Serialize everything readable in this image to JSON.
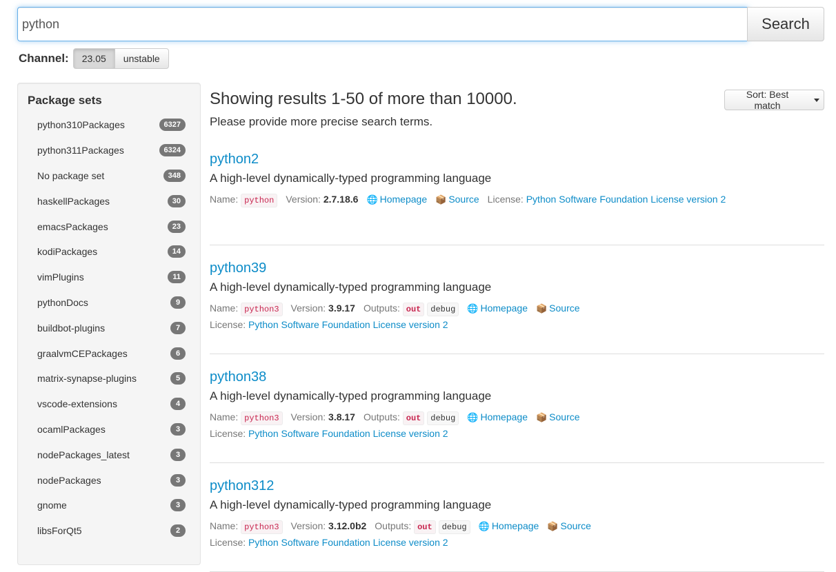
{
  "search": {
    "value": "python",
    "button_label": "Search"
  },
  "channel": {
    "label": "Channel:",
    "options": [
      "23.05",
      "unstable"
    ],
    "selected": "23.05"
  },
  "sidebar": {
    "title": "Package sets",
    "items": [
      {
        "label": "python310Packages",
        "count": "6327"
      },
      {
        "label": "python311Packages",
        "count": "6324"
      },
      {
        "label": "No package set",
        "count": "348"
      },
      {
        "label": "haskellPackages",
        "count": "30"
      },
      {
        "label": "emacsPackages",
        "count": "23"
      },
      {
        "label": "kodiPackages",
        "count": "14"
      },
      {
        "label": "vimPlugins",
        "count": "11"
      },
      {
        "label": "pythonDocs",
        "count": "9"
      },
      {
        "label": "buildbot-plugins",
        "count": "7"
      },
      {
        "label": "graalvmCEPackages",
        "count": "6"
      },
      {
        "label": "matrix-synapse-plugins",
        "count": "5"
      },
      {
        "label": "vscode-extensions",
        "count": "4"
      },
      {
        "label": "ocamlPackages",
        "count": "3"
      },
      {
        "label": "nodePackages_latest",
        "count": "3"
      },
      {
        "label": "nodePackages",
        "count": "3"
      },
      {
        "label": "gnome",
        "count": "3"
      },
      {
        "label": "libsForQt5",
        "count": "2"
      }
    ]
  },
  "main": {
    "heading": "Showing results 1-50 of more than 10000.",
    "subheading": "Please provide more precise search terms.",
    "sort_label": "Sort: Best match"
  },
  "labels": {
    "name": "Name:",
    "version": "Version:",
    "outputs": "Outputs:",
    "license": "License:",
    "homepage": "Homepage",
    "source": "Source"
  },
  "icons": {
    "homepage": "globe-icon",
    "source": "package-icon"
  },
  "results": [
    {
      "title": "python2",
      "description": "A high-level dynamically-typed programming language",
      "attr_name": "python",
      "version": "2.7.18.6",
      "outputs": [],
      "license": "Python Software Foundation License version 2"
    },
    {
      "title": "python39",
      "description": "A high-level dynamically-typed programming language",
      "attr_name": "python3",
      "version": "3.9.17",
      "outputs": [
        "out",
        "debug"
      ],
      "license": "Python Software Foundation License version 2"
    },
    {
      "title": "python38",
      "description": "A high-level dynamically-typed programming language",
      "attr_name": "python3",
      "version": "3.8.17",
      "outputs": [
        "out",
        "debug"
      ],
      "license": "Python Software Foundation License version 2"
    },
    {
      "title": "python312",
      "description": "A high-level dynamically-typed programming language",
      "attr_name": "python3",
      "version": "3.12.0b2",
      "outputs": [
        "out",
        "debug"
      ],
      "license": "Python Software Foundation License version 2"
    }
  ],
  "colors": {
    "link": "#0d8cc8",
    "badge": "#777777",
    "code": "#c7254e"
  }
}
